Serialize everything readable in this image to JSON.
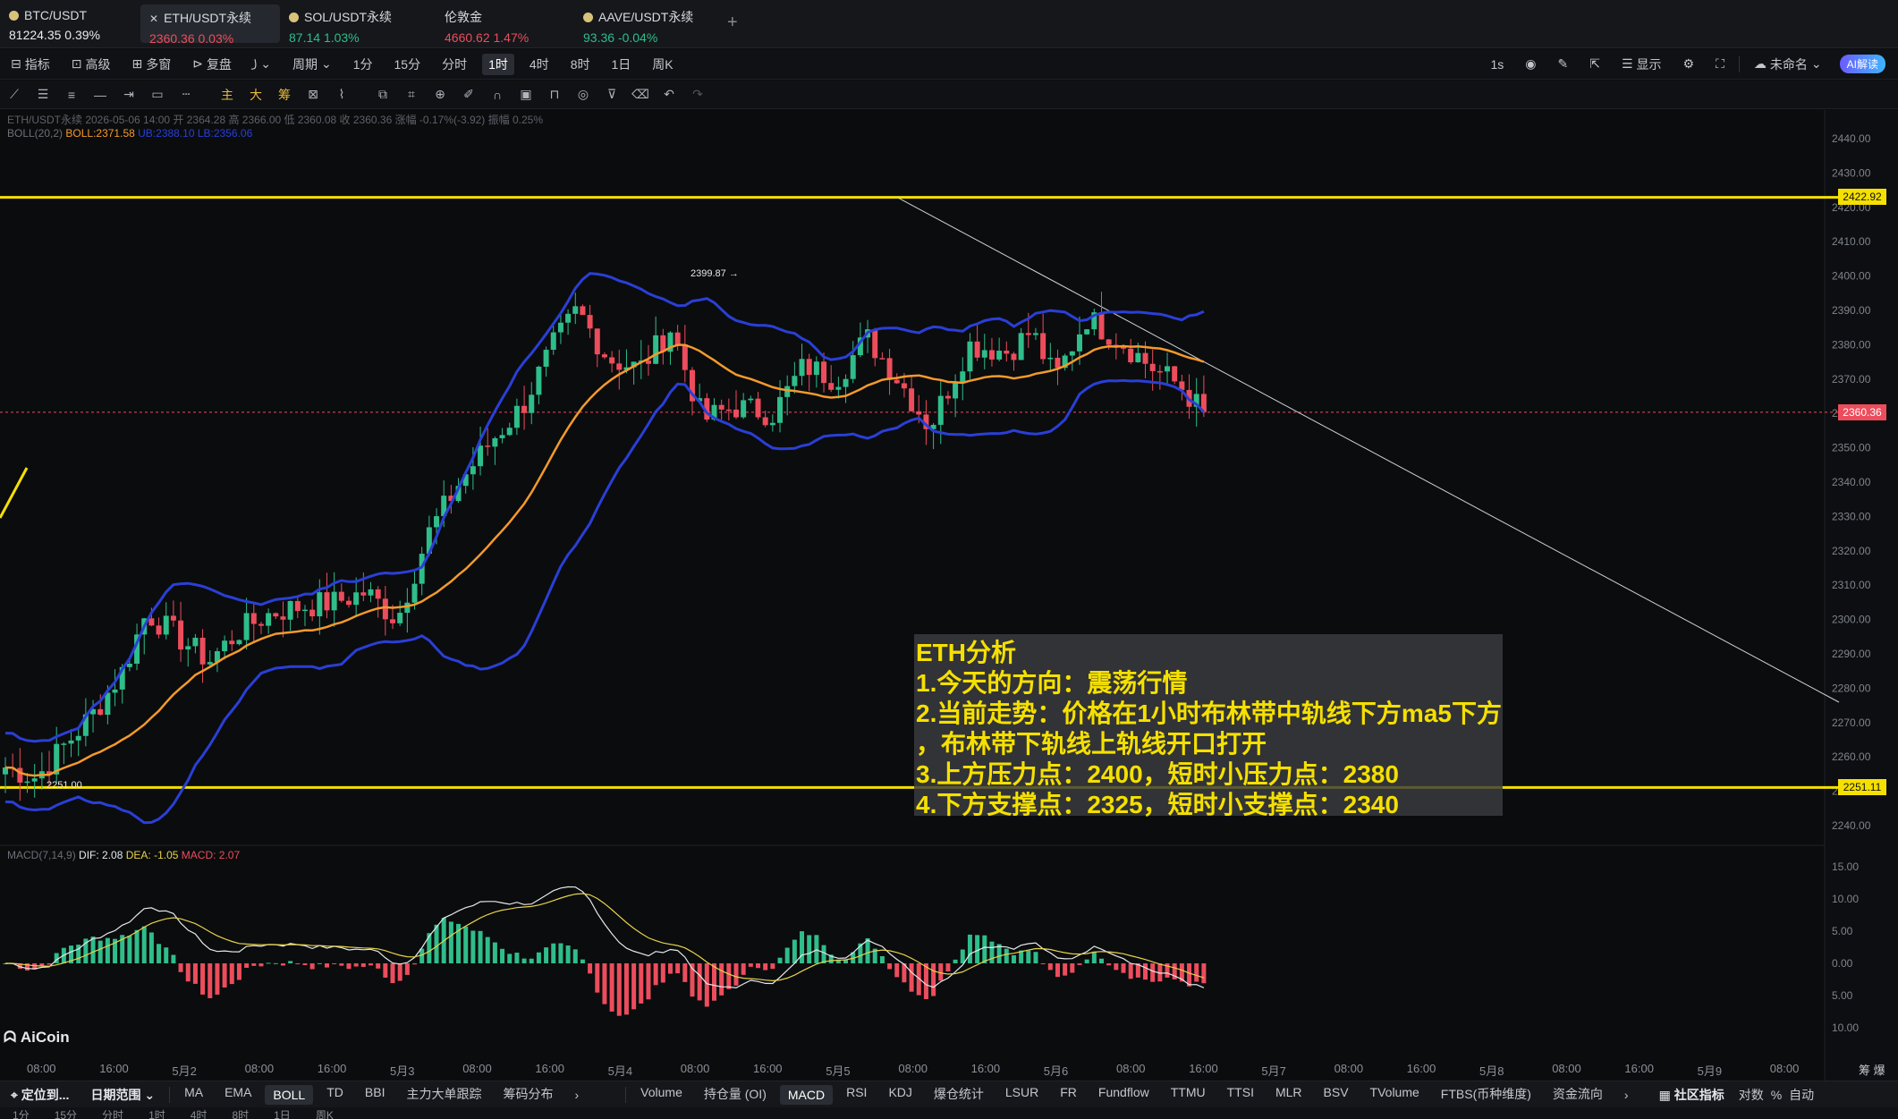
{
  "tickers": [
    {
      "name": "BTC/USDT",
      "price": "81224.35",
      "change": "0.39%",
      "dir": "up"
    },
    {
      "name": "ETH/USDT永续",
      "price": "2360.36",
      "change": "0.03%",
      "dir": "dn"
    },
    {
      "name": "SOL/USDT永续",
      "price": "87.14",
      "change": "1.03%",
      "dir": "up"
    },
    {
      "name": "伦敦金",
      "price": "4660.62",
      "change": "1.47%",
      "dir": "dn"
    },
    {
      "name": "AAVE/USDT永续",
      "price": "93.36",
      "change": "-0.04%",
      "dir": "up"
    }
  ],
  "add_tab": "+",
  "toolbar": {
    "indicators": "指标",
    "advanced": "高级",
    "multi_window": "多窗",
    "replay": "复盘",
    "period": "周期",
    "intervals": [
      "1分",
      "15分",
      "分时",
      "1时",
      "4时",
      "8时",
      "1日",
      "周K"
    ],
    "selected_interval": "1时",
    "speed": "1s",
    "display": "显示",
    "unnamed": "未命名",
    "ai_read": "AI解读"
  },
  "legend": {
    "ohlc": "ETH/USDT永续 2026-05-06 14:00 开 2364.28 高 2366.00 低 2360.08 收 2360.36 涨幅 -0.17%(-3.92) 振幅 0.25%",
    "boll_label": "BOLL(20,2)",
    "boll_mid": "BOLL:2371.58",
    "boll_ub_lb": "UB:2388.10 LB:2356.06",
    "macd_label": "MACD(7,14,9)",
    "macd_dif": "DIF: 2.08",
    "macd_dea": "DEA: -1.05",
    "macd_val": "MACD: 2.07"
  },
  "price_axis": [
    "2440.00",
    "2430.00",
    "2420.00",
    "2410.00",
    "2400.00",
    "2390.00",
    "2380.00",
    "2370.00",
    "2360.00",
    "2350.00",
    "2340.00",
    "2330.00",
    "2320.00",
    "2310.00",
    "2300.00",
    "2290.00",
    "2280.00",
    "2270.00",
    "2260.00",
    "2250.00",
    "2240.00"
  ],
  "macd_axis": [
    "15.00",
    "10.00",
    "5.00",
    "0.00",
    "5.00",
    "10.00"
  ],
  "price_tags": {
    "resistance": "2422.92",
    "current": "2360.36",
    "support": "2251.11"
  },
  "annotations": {
    "high_marker": "2399.87",
    "low_marker": "2251.00"
  },
  "analysis": {
    "title": "ETH分析",
    "lines": [
      "1.今天的方向：震荡行情",
      "2.当前走势：价格在1小时布林带中轨线下方ma5下方",
      "，布林带下轨线上轨线开口打开",
      "3.上方压力点：2400，短时小压力点：2380",
      "4.下方支撑点：2325，短时小支撑点：2340"
    ]
  },
  "time_axis": [
    "08:00",
    "16:00",
    "5月2",
    "08:00",
    "16:00",
    "5月3",
    "08:00",
    "16:00",
    "5月4",
    "08:00",
    "16:00",
    "5月5",
    "08:00",
    "16:00",
    "5月6",
    "08:00",
    "16:00",
    "5月7",
    "08:00",
    "16:00",
    "5月8",
    "08:00",
    "16:00",
    "5月9",
    "08:00"
  ],
  "time_axis_right": "筹 爆",
  "watermark": "AiCoin",
  "bottom_bar": {
    "locate": "定位到...",
    "date_range": "日期范围",
    "main_indicators": [
      "MA",
      "EMA",
      "BOLL",
      "TD",
      "BBI",
      "主力大单跟踪",
      "筹码分布"
    ],
    "selected_main": "BOLL",
    "sub_indicators": [
      "Volume",
      "持仓量 (OI)",
      "MACD",
      "RSI",
      "KDJ",
      "爆仓统计",
      "LSUR",
      "FR",
      "Fundflow",
      "TTMU",
      "TTSI",
      "MLR",
      "BSV",
      "TVolume",
      "FTBS(币种维度)",
      "资金流向"
    ],
    "selected_sub": "MACD",
    "community": "社区指标",
    "log": "对数",
    "percent": "%",
    "auto": "自动"
  },
  "bottom_strip": [
    "1分",
    "15分",
    "分时",
    "1时",
    "4时",
    "8时",
    "1日",
    "周K"
  ],
  "colors": {
    "up": "#2fbd8a",
    "down": "#ec4d5c",
    "boll_band": "#2a3fd6",
    "boll_mid": "#f39a2b",
    "support_line": "#f5e000",
    "analysis_text": "#f5e000"
  }
}
